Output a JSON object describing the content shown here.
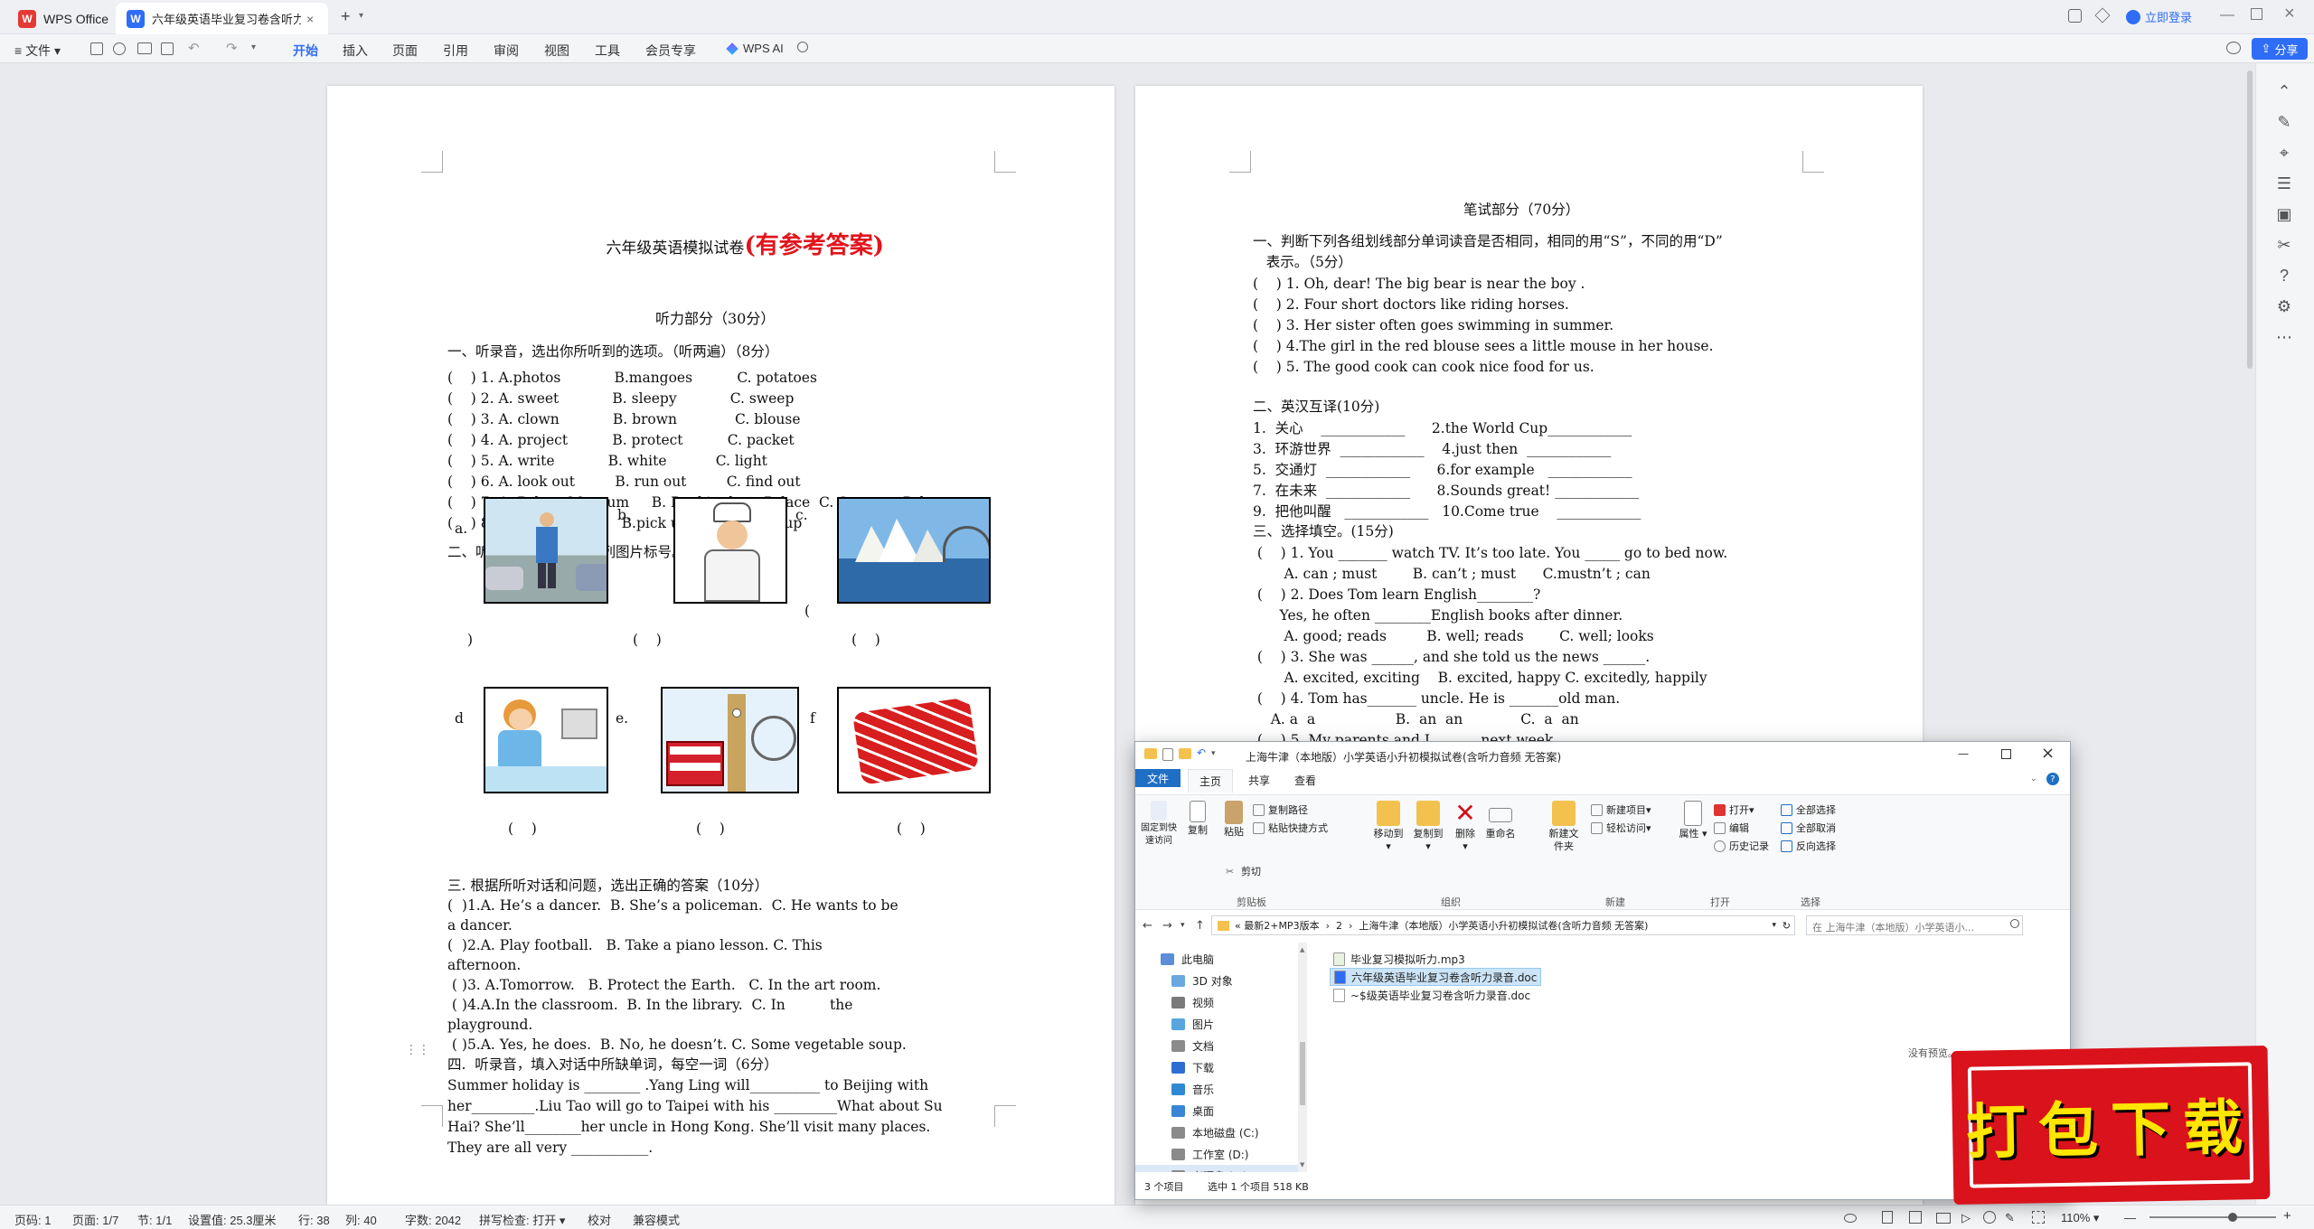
{
  "app": {
    "brand": "WPS Office",
    "doc_tab": "六年级英语毕业复习卷含听力..",
    "new_tab": "+",
    "login": "立即登录",
    "share": "分享"
  },
  "toolbar": {
    "file": "文件",
    "menus": [
      "开始",
      "插入",
      "页面",
      "引用",
      "审阅",
      "视图",
      "工具",
      "会员专享"
    ],
    "ai": "WPS AI"
  },
  "page1": {
    "title": "六年级英语模拟试卷",
    "title_red": "(有参考答案)",
    "lines": [
      "听力部分（30分）",
      "一、听录音，选出你所听到的选项。（听两遍）（8分）",
      "(    ) 1. A.photos            B.mangoes          C. potatoes",
      "(    ) 2. A. sweet            B. sleepy            C. sweep",
      "(    ) 3. A. clown            B. brown             C. blouse",
      "(    ) 4. A. project          B. protect          C. packet",
      "(    ) 5. A. write            B. white           C. light",
      "(    ) 6. A. look out         B. run out         C. find out",
      "(    ) 7. A. Palace Museum     B. Buckingham Palace  C. Summer Palace",
      "(    ) 8. A.wake up           B.pick up           C. get up",
      "二、听录音，用数字给下列图片标号。（听两遍）（6分）",
      "三. 根据所听对话和问题，选出正确的答案（10分）",
      "(  )1.A. He’s a dancer.  B. She’s a policeman.  C. He wants to be",
      "a dancer.",
      "(  )2.A. Play football.   B. Take a piano lesson. C. This",
      "afternoon.",
      " ( )3. A.Tomorrow.   B. Protect the Earth.   C. In the art room.",
      " ( )4.A.In the classroom.  B. In the library.  C. In          the",
      "playground.",
      " ( )5.A. Yes, he does.  B. No, he doesn’t. C. Some vegetable soup.",
      "四.  听录音，填入对话中所缺单词，每空一词（6分）",
      "Summer holiday is ________ .Yang Ling will__________ to Beijing with",
      "her_________.Liu Tao will go to Taipei with his _________What about Su",
      "Hai? She’ll________her uncle in Hong Kong. She’ll visit many places.",
      "They are all very ___________."
    ],
    "pic_labels": [
      "a.",
      "b.",
      "c.",
      "d",
      "e.",
      "f"
    ],
    "brackets": [
      ")",
      "(    )",
      "(",
      "(    )",
      "(    )",
      "(    )",
      "(    )"
    ]
  },
  "page2": {
    "lines": [
      "笔试部分（70分）",
      "一、判断下列各组划线部分单词读音是否相同，相同的用“S”，不同的用“D”",
      "   表示。（5分）",
      "(    ) 1. Oh, dear! The big bear is near the boy .",
      "(    ) 2. Four short doctors like riding horses.",
      "(    ) 3. Her sister often goes swimming in summer.",
      "(    ) 4.The girl in the red blouse sees a little mouse in her house.",
      "(    ) 5. The good cook can cook nice food for us.",
      "二、英汉互译(10分)",
      "1.  关心    ____________      2.the World Cup____________",
      "3.  环游世界  ____________    4.just then  ____________",
      "5.  交通灯  ____________      6.for example   ____________",
      "7.  在未来  ____________      8.Sounds great! ____________",
      "9.  把他叫醒   ____________   10.Come true    ____________",
      "三、选择填空。(15分)",
      " (    ) 1. You _______ watch TV. It’s too late. You _____ go to bed now.",
      "       A. can ; must        B. can’t ; must      C.mustn’t ; can",
      " (    ) 2. Does Tom learn English________?",
      "      Yes, he often ________English books after dinner.",
      "       A. good; reads         B. well; reads        C. well; looks",
      " (    ) 3. She was ______, and she told us the news ______.",
      "       A. excited, exciting    B. excited, happy C. excitedly, happily",
      " (    ) 4. Tom has_______ uncle. He is _______old man.",
      "    A. a  a                  B.  an  an             C.  a  an",
      " (    ) 5. My parents and I ______ next week."
    ]
  },
  "explorer": {
    "title": "上海牛津（本地版）小学英语小升初模拟试卷(含听力音频 无答案)",
    "tabs": [
      "文件",
      "主页",
      "共享",
      "查看"
    ],
    "ribbon": {
      "pin": "固定到快速访问",
      "copy": "复制",
      "paste": "粘贴",
      "copy_path": "复制路径",
      "paste_shortcut": "粘贴快捷方式",
      "cut": "剪切",
      "move_to": "移动到",
      "copy_to": "复制到",
      "delete": "删除",
      "rename": "重命名",
      "new_folder": "新建文件夹",
      "new_item": "新建项目",
      "easy_access": "轻松访问",
      "properties": "属性",
      "open": "打开",
      "edit": "编辑",
      "history": "历史记录",
      "select_all": "全部选择",
      "select_none": "全部取消",
      "invert": "反向选择",
      "groups": [
        "剪贴板",
        "组织",
        "新建",
        "打开",
        "选择"
      ]
    },
    "path": [
      "«  最新2+MP3版本",
      "2",
      "上海牛津（本地版）小学英语小升初模拟试卷(含听力音频 无答案)"
    ],
    "search_placeholder": "在 上海牛津（本地版）小学英语小...",
    "nav": [
      "此电脑",
      "3D 对象",
      "视频",
      "图片",
      "文档",
      "下载",
      "音乐",
      "桌面",
      "本地磁盘 (C:)",
      "工作室 (D:)",
      "老硬盘 (E:)"
    ],
    "files": [
      "毕业复习模拟听力.mp3",
      "六年级英语毕业复习卷含听力录音.doc",
      "~$级英语毕业复习卷含听力录音.doc"
    ],
    "preview": "没有预览。",
    "status": {
      "count": "3 个项目",
      "selected": "选中 1 个项目  518 KB"
    }
  },
  "badge": {
    "text": "打包下载"
  },
  "status": {
    "page": "页码: 1",
    "pages": "页面: 1/7",
    "section": "节: 1/1",
    "setting": "设置值: 25.3厘米",
    "row": "行: 38",
    "col": "列: 40",
    "words": "字数: 2042",
    "spell": "拼写检查: 打开",
    "proof": "校对",
    "compat": "兼容模式",
    "zoom": "110%"
  },
  "colors": {
    "accent": "#2f6df6",
    "brand_red": "#e53935",
    "badge_red": "#d9121b",
    "badge_text": "#ffe600"
  }
}
